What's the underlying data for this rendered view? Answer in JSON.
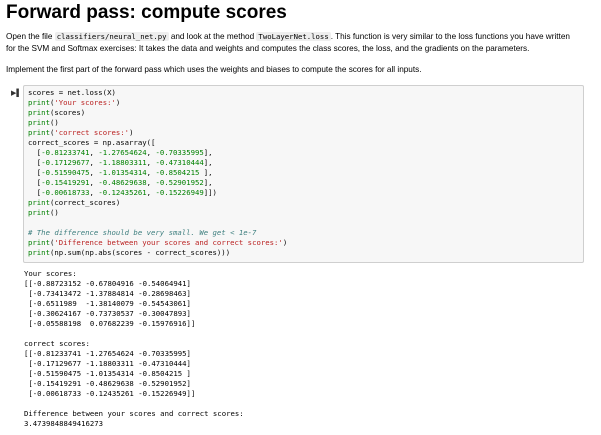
{
  "title": "Forward pass: compute scores",
  "intro": {
    "line1_a": "Open the file",
    "file_path": "classifiers/neural_net.py",
    "line1_b": "and look at the method",
    "method": "TwoLayerNet.loss",
    "line1_c": ". This function is very similar to the loss functions you have written",
    "line2": "for the SVM and Softmax exercises: It takes the data and weights and computes the class scores, the loss, and the gradients on the parameters.",
    "line3": "Implement the first part of the forward pass which uses the weights and biases to compute the scores for all inputs."
  },
  "code_lines": [
    "scores = net.loss(X)",
    "print('Your scores:')",
    "print(scores)",
    "print()",
    "print('correct scores:')",
    "correct_scores = np.asarray([",
    "  [-0.81233741, -1.27654624, -0.70335995],",
    "  [-0.17129677, -1.18803311, -0.47310444],",
    "  [-0.51590475, -1.01354314, -0.8504215 ],",
    "  [-0.15419291, -0.48629638, -0.52901952],",
    "  [-0.00618733, -0.12435261, -0.15226949]])",
    "print(correct_scores)",
    "print()",
    "",
    "# The difference should be very small. We get < 1e-7",
    "print('Difference between your scores and correct scores:')",
    "print(np.sum(np.abs(scores - correct_scores)))"
  ],
  "output_lines": [
    "Your scores:",
    "[[-0.88723152 -0.67804916 -0.54064941]",
    " [-0.73413472 -1.37884814 -0.28698463]",
    " [-0.6511989  -1.38140079 -0.54543061]",
    " [-0.30624167 -0.73730537 -0.30047893]",
    " [-0.05588198  0.07682239 -0.15976916]]",
    "",
    "correct scores:",
    "[[-0.81233741 -1.27654624 -0.70335995]",
    " [-0.17129677 -1.18803311 -0.47310444]",
    " [-0.51590475 -1.01354314 -0.8504215 ]",
    " [-0.15419291 -0.48629638 -0.52901952]",
    " [-0.00618733 -0.12435261 -0.15226949]]",
    "",
    "Difference between your scores and correct scores:",
    "3.4739848849416273"
  ],
  "run_icon": "run-cell-icon"
}
